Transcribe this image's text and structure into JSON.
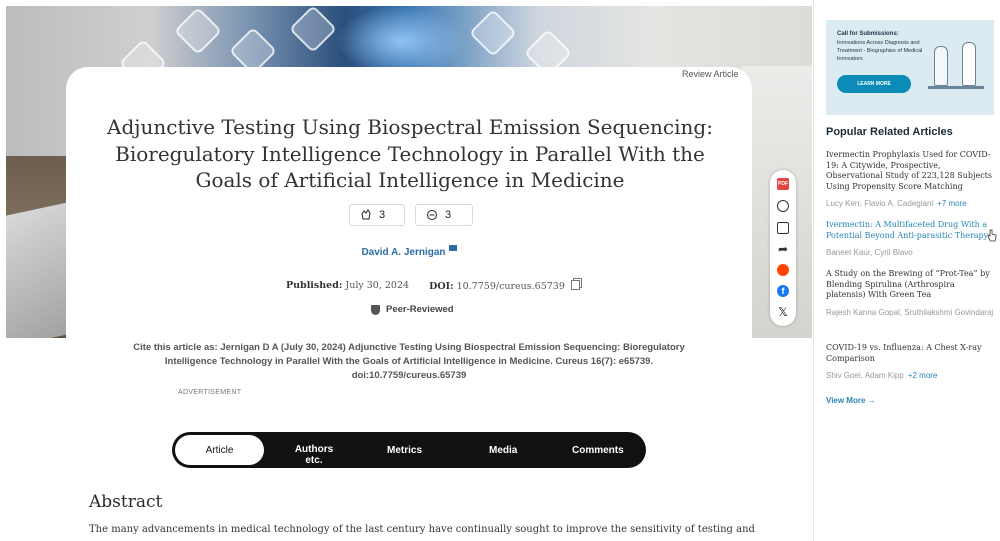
{
  "article": {
    "type": "Review Article",
    "title": "Adjunctive Testing Using Biospectral Emission Sequencing: Bioregulatory Intelligence Technology in Parallel With the Goals of Artificial Intelligence in Medicine",
    "claps": "3",
    "comments": "3",
    "author": "David A. Jernigan",
    "published_label": "Published:",
    "published_date": "July 30, 2024",
    "doi_label": "DOI:",
    "doi": "10.7759/cureus.65739",
    "peer_reviewed": "Peer-Reviewed",
    "cite": "Cite this article as: Jernigan D A (July 30, 2024) Adjunctive Testing Using Biospectral Emission Sequencing: Bioregulatory Intelligence Technology in Parallel With the Goals of Artificial Intelligence in Medicine. Cureus 16(7): e65739. doi:10.7759/cureus.65739",
    "advertisement": "ADVERTISEMENT"
  },
  "share": {
    "pdf": "PDF",
    "icons": [
      "pdf-icon",
      "globe-icon",
      "mail-icon",
      "share-icon",
      "reddit-icon",
      "facebook-icon",
      "x-icon"
    ]
  },
  "tabs": {
    "article": "Article",
    "authors": "Authors etc.",
    "metrics": "Metrics",
    "media": "Media",
    "comments": "Comments"
  },
  "abstract": {
    "heading": "Abstract",
    "text": "The many advancements in medical technology of the last century have continually sought to improve the sensitivity of testing and"
  },
  "sidebar": {
    "ad": {
      "title": "Call for Submissions:",
      "body": "Innovations Across Diagnosis and Treatment - Biographies of Medical Innovators",
      "button": "LEARN MORE"
    },
    "popular_heading": "Popular Related Articles",
    "items": [
      {
        "title": "Ivermectin Prophylaxis Used for COVID-19: A Citywide, Prospective, Observational Study of 223,128 Subjects Using Propensity Score Matching",
        "authors": "Lucy Kerr, Flavio A. Cadegiani",
        "more": "+7 more"
      },
      {
        "title": "Ivermectin: A Multifaceted Drug With a Potential Beyond Anti-parasitic Therapy",
        "authors": "Baneet Kaur, Cyril Blavo",
        "more": ""
      },
      {
        "title": "A Study on the Brewing of “Prot-Tea” by Blending Spirulina (Arthrospira platensis) With Green Tea",
        "authors": "Rajesh Kanna Gopal, Sruthilakshmi Govindaraj",
        "more": ""
      },
      {
        "title": "COVID-19 vs. Influenza: A Chest X-ray Comparison",
        "authors": "Shiv Goel, Adam Kipp",
        "more": "+2 more"
      }
    ],
    "view_more": "View More →"
  }
}
